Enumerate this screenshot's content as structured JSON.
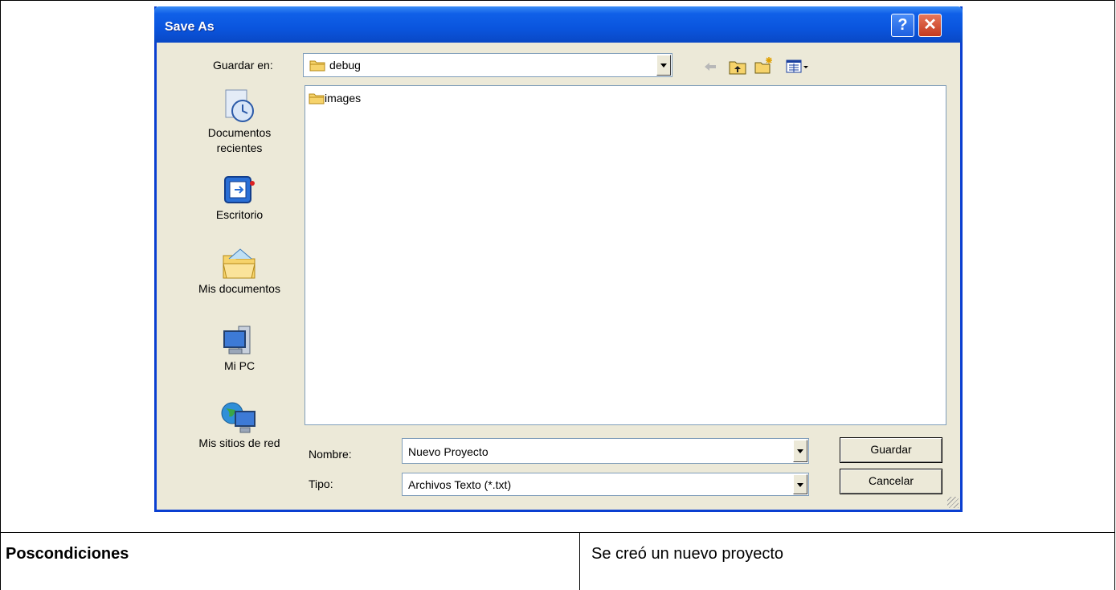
{
  "dialog": {
    "title": "Save As",
    "help_glyph": "?",
    "close_glyph": "✕",
    "save_in_label": "Guardar en:",
    "save_in_value": "debug",
    "toolbar": {
      "back_icon": "back-arrow-icon",
      "up_icon": "up-folder-icon",
      "new_folder_icon": "new-folder-icon",
      "views_icon": "views-menu-icon"
    },
    "places": [
      {
        "label_line1": "Documentos",
        "label_line2": "recientes",
        "icon": "recent-documents-icon"
      },
      {
        "label_line1": "Escritorio",
        "label_line2": "",
        "icon": "desktop-icon"
      },
      {
        "label_line1": "Mis documentos",
        "label_line2": "",
        "icon": "my-documents-icon"
      },
      {
        "label_line1": "Mi PC",
        "label_line2": "",
        "icon": "my-computer-icon"
      },
      {
        "label_line1": "Mis sitios de red",
        "label_line2": "",
        "icon": "network-places-icon"
      }
    ],
    "files": [
      {
        "name": "images",
        "icon": "folder-icon"
      }
    ],
    "filename_label": "Nombre:",
    "filename_value": "Nuevo Proyecto",
    "type_label": "Tipo:",
    "type_value": "Archivos Texto (*.txt)",
    "save_button": "Guardar",
    "cancel_button": "Cancelar"
  },
  "table": {
    "label": "Poscondiciones",
    "value": "Se creó un nuevo proyecto"
  }
}
